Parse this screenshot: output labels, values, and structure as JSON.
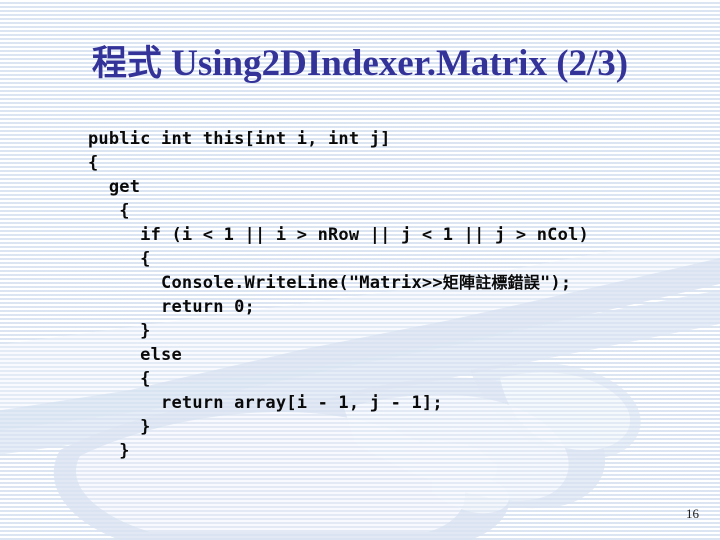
{
  "slide": {
    "title_cjk": "程式",
    "title_latin": " Using2DIndexer.Matrix (2/3)",
    "title_color": "#333399",
    "page_number": "16",
    "background": {
      "stripe_light": "#ffffff",
      "stripe_blue": "#e2e9f4",
      "artwork": "handshake-watermark"
    }
  },
  "code": {
    "language": "csharp",
    "text_color": "#0a0a0a",
    "lines": [
      "public int this[int i, int j]",
      "{",
      "  get",
      "   {",
      "     if (i < 1 || i > nRow || j < 1 || j > nCol)",
      "     {",
      "       Console.WriteLine(\"Matrix>>矩陣註標錯誤\");",
      "       return 0;",
      "     }",
      "     else",
      "     {",
      "       return array[i - 1, j - 1];",
      "     }",
      "   }"
    ],
    "line_parts": [
      [
        {
          "t": "public int this[int i, int j]",
          "cjk": false
        }
      ],
      [
        {
          "t": "{",
          "cjk": false
        }
      ],
      [
        {
          "t": "  get",
          "cjk": false
        }
      ],
      [
        {
          "t": "   {",
          "cjk": false
        }
      ],
      [
        {
          "t": "     if (i < 1 || i > nRow || j < 1 || j > nCol)",
          "cjk": false
        }
      ],
      [
        {
          "t": "     {",
          "cjk": false
        }
      ],
      [
        {
          "t": "       Console.WriteLine(\"Matrix>>",
          "cjk": false
        },
        {
          "t": "矩陣註標錯誤",
          "cjk": true
        },
        {
          "t": "\");",
          "cjk": false
        }
      ],
      [
        {
          "t": "       return 0;",
          "cjk": false
        }
      ],
      [
        {
          "t": "     }",
          "cjk": false
        }
      ],
      [
        {
          "t": "     else",
          "cjk": false
        }
      ],
      [
        {
          "t": "     {",
          "cjk": false
        }
      ],
      [
        {
          "t": "       return array[i - 1, j - 1];",
          "cjk": false
        }
      ],
      [
        {
          "t": "     }",
          "cjk": false
        }
      ],
      [
        {
          "t": "   }",
          "cjk": false
        }
      ]
    ]
  }
}
